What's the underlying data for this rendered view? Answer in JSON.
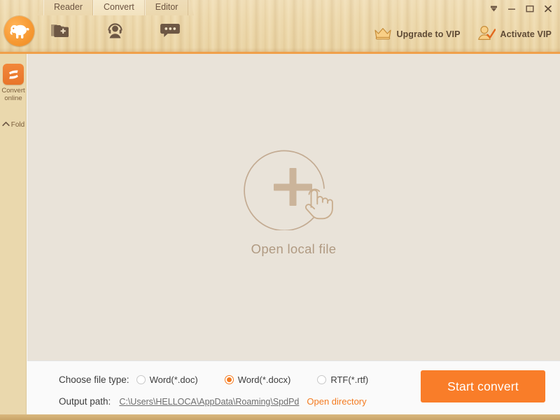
{
  "window": {
    "controls": [
      {
        "name": "pin-button",
        "label": "⮟"
      },
      {
        "name": "minimize-button",
        "label": "–"
      },
      {
        "name": "maximize-button",
        "label": "☐"
      },
      {
        "name": "close-button",
        "label": "✕"
      }
    ]
  },
  "header": {
    "logo_icon": "elephant-logo-icon",
    "tabs": [
      {
        "label": "Reader",
        "active": false
      },
      {
        "label": "Convert",
        "active": true
      },
      {
        "label": "Editor",
        "active": false
      }
    ],
    "tool_icons": [
      {
        "name": "add-folder-icon",
        "title": "Add folder"
      },
      {
        "name": "support-agent-icon",
        "title": "Support"
      },
      {
        "name": "feedback-bubble-icon",
        "title": "Feedback"
      }
    ],
    "upgrade_vip_label": "Upgrade to VIP",
    "upgrade_vip_icon": "crown-icon",
    "activate_vip_label": "Activate VIP",
    "activate_vip_icon": "user-check-icon"
  },
  "sidebar": {
    "convert_online_label": "Convert\nonline",
    "convert_online_line1": "Convert",
    "convert_online_line2": "online",
    "convert_online_icon": "swap-arrows-icon",
    "fold_label": "Fold",
    "fold_icon": "chevron-up-icon"
  },
  "dropzone": {
    "plus_icon": "plus-circle-icon",
    "cursor_icon": "pointing-hand-icon",
    "open_file_label": "Open local file"
  },
  "bottom": {
    "file_type_label": "Choose file type:",
    "file_types": [
      {
        "label": "Word(*.doc)",
        "selected": false
      },
      {
        "label": "Word(*.docx)",
        "selected": true
      },
      {
        "label": "RTF(*.rtf)",
        "selected": false
      }
    ],
    "output_path_label": "Output path:",
    "output_path_value": "C:\\Users\\HELLOCA\\AppData\\Roaming\\SpdPd",
    "open_directory_label": "Open directory",
    "start_convert_label": "Start convert"
  },
  "colors": {
    "accent_orange": "#f97d29",
    "wood": "#ecd7aa",
    "sidebar": "#ead8ad",
    "dropzone": "#e9e3d9"
  }
}
